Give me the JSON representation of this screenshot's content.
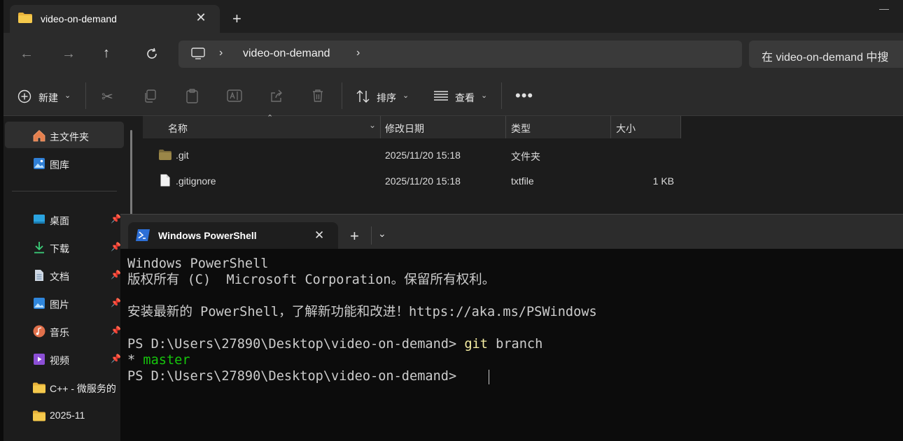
{
  "explorer": {
    "tab_title": "video-on-demand",
    "address": {
      "segment": "video-on-demand"
    },
    "search_placeholder": "在 video-on-demand 中搜",
    "toolbar": {
      "new_label": "新建",
      "sort_label": "排序",
      "view_label": "查看"
    },
    "sidebar": {
      "items": [
        {
          "label": "主文件夹",
          "icon": "home-icon"
        },
        {
          "label": "图库",
          "icon": "gallery-icon"
        },
        {
          "label": "桌面",
          "icon": "desktop-icon"
        },
        {
          "label": "下载",
          "icon": "download-icon"
        },
        {
          "label": "文档",
          "icon": "document-icon"
        },
        {
          "label": "图片",
          "icon": "pictures-icon"
        },
        {
          "label": "音乐",
          "icon": "music-icon"
        },
        {
          "label": "视频",
          "icon": "video-icon"
        },
        {
          "label": "C++ - 微服务的",
          "icon": "folder-icon"
        },
        {
          "label": "2025-11",
          "icon": "folder-icon"
        }
      ]
    },
    "columns": [
      "名称",
      "修改日期",
      "类型",
      "大小"
    ],
    "files": [
      {
        "name": ".git",
        "modified": "2025/11/20 15:18",
        "type": "文件夹",
        "size": ""
      },
      {
        "name": ".gitignore",
        "modified": "2025/11/20 15:18",
        "type": "txtfile",
        "size": "1 KB"
      }
    ]
  },
  "terminal": {
    "tab_title": "Windows PowerShell",
    "lines": {
      "l1": "Windows PowerShell",
      "l2": "版权所有 (C)  Microsoft Corporation。保留所有权利。",
      "l3": "安装最新的 PowerShell，了解新功能和改进！https://aka.ms/PSWindows",
      "prompt1": "PS D:\\Users\\27890\\Desktop\\video-on-demand> ",
      "cmd_git": "git",
      "cmd_args": " branch",
      "branch_star": "* ",
      "branch_name": "master",
      "prompt2": "PS D:\\Users\\27890\\Desktop\\video-on-demand> "
    }
  },
  "colors": {
    "accent_folder": "#e8b23a",
    "terminal_green": "#16c60c",
    "terminal_yellow": "#f9f1a5"
  }
}
